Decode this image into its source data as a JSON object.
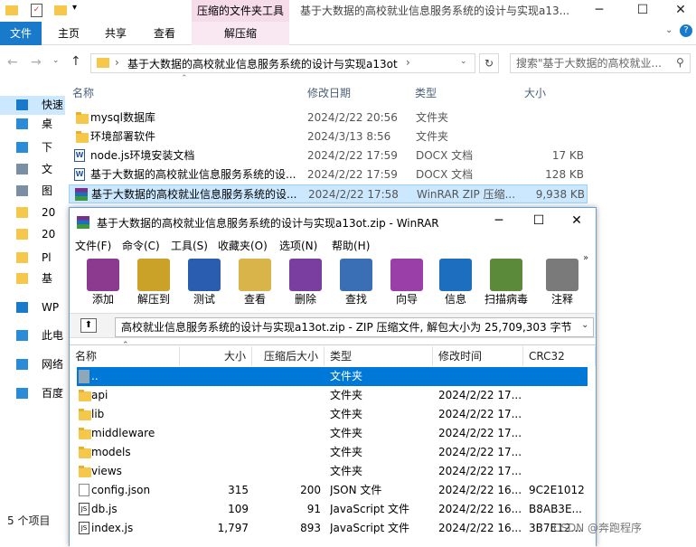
{
  "explorer": {
    "contextual_tab": "压缩的文件夹工具",
    "window_title": "基于大数据的高校就业信息服务系统的设计与实现a13...",
    "ribbon_tabs": [
      "文件",
      "主页",
      "共享",
      "查看"
    ],
    "contextual_subtab": "解压缩",
    "address_path": "基于大数据的高校就业信息服务系统的设计与实现a13ot",
    "search_placeholder": "搜索\"基于大数据的高校就业...",
    "columns": {
      "name": "名称",
      "date": "修改日期",
      "type": "类型",
      "size": "大小"
    },
    "files": [
      {
        "icon": "folder-icon",
        "name": "mysql数据库",
        "date": "2024/2/22 20:56",
        "type": "文件夹",
        "size": ""
      },
      {
        "icon": "folder-icon",
        "name": "环境部署软件",
        "date": "2024/3/13 8:56",
        "type": "文件夹",
        "size": ""
      },
      {
        "icon": "word-doc-icon",
        "name": "node.js环境安装文档",
        "date": "2024/2/22 17:59",
        "type": "DOCX 文档",
        "size": "17 KB"
      },
      {
        "icon": "word-doc-icon",
        "name": "基于大数据的高校就业信息服务系统的设...",
        "date": "2024/2/22 17:59",
        "type": "DOCX 文档",
        "size": "128 KB"
      },
      {
        "icon": "rar-archive-icon",
        "name": "基于大数据的高校就业信息服务系统的设...",
        "date": "2024/2/22 17:58",
        "type": "WinRAR ZIP 压缩...",
        "size": "9,938 KB"
      }
    ],
    "nav_items": [
      {
        "icon": "quick-access-icon",
        "label": "快速"
      },
      {
        "icon": "desktop-icon",
        "label": "桌"
      },
      {
        "icon": "downloads-icon",
        "label": "下"
      },
      {
        "icon": "documents-icon",
        "label": "文"
      },
      {
        "icon": "pictures-icon",
        "label": "图"
      },
      {
        "icon": "folder-icon",
        "label": "20"
      },
      {
        "icon": "folder-icon",
        "label": "20"
      },
      {
        "icon": "folder-icon",
        "label": "Pl"
      },
      {
        "icon": "folder-icon",
        "label": "基"
      },
      {
        "icon": "onedrive-icon",
        "label": "WP"
      },
      {
        "icon": "this-pc-icon",
        "label": "此电"
      },
      {
        "icon": "network-icon",
        "label": "网络"
      },
      {
        "icon": "baidu-icon",
        "label": "百度"
      }
    ],
    "status": "5 个项目"
  },
  "winrar": {
    "title": "基于大数据的高校就业信息服务系统的设计与实现a13ot.zip - WinRAR",
    "menu": [
      "文件(F)",
      "命令(C)",
      "工具(S)",
      "收藏夹(O)",
      "选项(N)",
      "帮助(H)"
    ],
    "tools": [
      {
        "name": "add",
        "label": "添加"
      },
      {
        "name": "extract",
        "label": "解压到"
      },
      {
        "name": "test",
        "label": "测试"
      },
      {
        "name": "view",
        "label": "查看"
      },
      {
        "name": "delete",
        "label": "删除"
      },
      {
        "name": "find",
        "label": "查找"
      },
      {
        "name": "wizard",
        "label": "向导"
      },
      {
        "name": "info",
        "label": "信息"
      },
      {
        "name": "virusscan",
        "label": "扫描病毒"
      },
      {
        "name": "comment",
        "label": "注释"
      }
    ],
    "path_text": "高校就业信息服务系统的设计与实现a13ot.zip - ZIP 压缩文件, 解包大小为 25,709,303 字节",
    "columns": {
      "name": "名称",
      "size": "大小",
      "packed": "压缩后大小",
      "type": "类型",
      "modified": "修改时间",
      "crc": "CRC32"
    },
    "rows": [
      {
        "icon": "parent-folder-icon",
        "name": "..",
        "size": "",
        "packed": "",
        "type": "文件夹",
        "modified": "",
        "crc": ""
      },
      {
        "icon": "folder-icon",
        "name": "api",
        "size": "",
        "packed": "",
        "type": "文件夹",
        "modified": "2024/2/22 17...",
        "crc": ""
      },
      {
        "icon": "folder-icon",
        "name": "lib",
        "size": "",
        "packed": "",
        "type": "文件夹",
        "modified": "2024/2/22 17...",
        "crc": ""
      },
      {
        "icon": "folder-icon",
        "name": "middleware",
        "size": "",
        "packed": "",
        "type": "文件夹",
        "modified": "2024/2/22 17...",
        "crc": ""
      },
      {
        "icon": "folder-icon",
        "name": "models",
        "size": "",
        "packed": "",
        "type": "文件夹",
        "modified": "2024/2/22 17...",
        "crc": ""
      },
      {
        "icon": "folder-icon",
        "name": "views",
        "size": "",
        "packed": "",
        "type": "文件夹",
        "modified": "2024/2/22 17...",
        "crc": ""
      },
      {
        "icon": "json-file-icon",
        "name": "config.json",
        "size": "315",
        "packed": "200",
        "type": "JSON 文件",
        "modified": "2024/2/22 16...",
        "crc": "9C2E1012"
      },
      {
        "icon": "js-file-icon",
        "name": "db.js",
        "size": "109",
        "packed": "91",
        "type": "JavaScript 文件",
        "modified": "2024/2/22 16...",
        "crc": "B8AB3E..."
      },
      {
        "icon": "js-file-icon",
        "name": "index.js",
        "size": "1,797",
        "packed": "893",
        "type": "JavaScript 文件",
        "modified": "2024/2/22 16...",
        "crc": "3B7E129..."
      }
    ]
  },
  "watermark": "CSDN @奔跑程序"
}
